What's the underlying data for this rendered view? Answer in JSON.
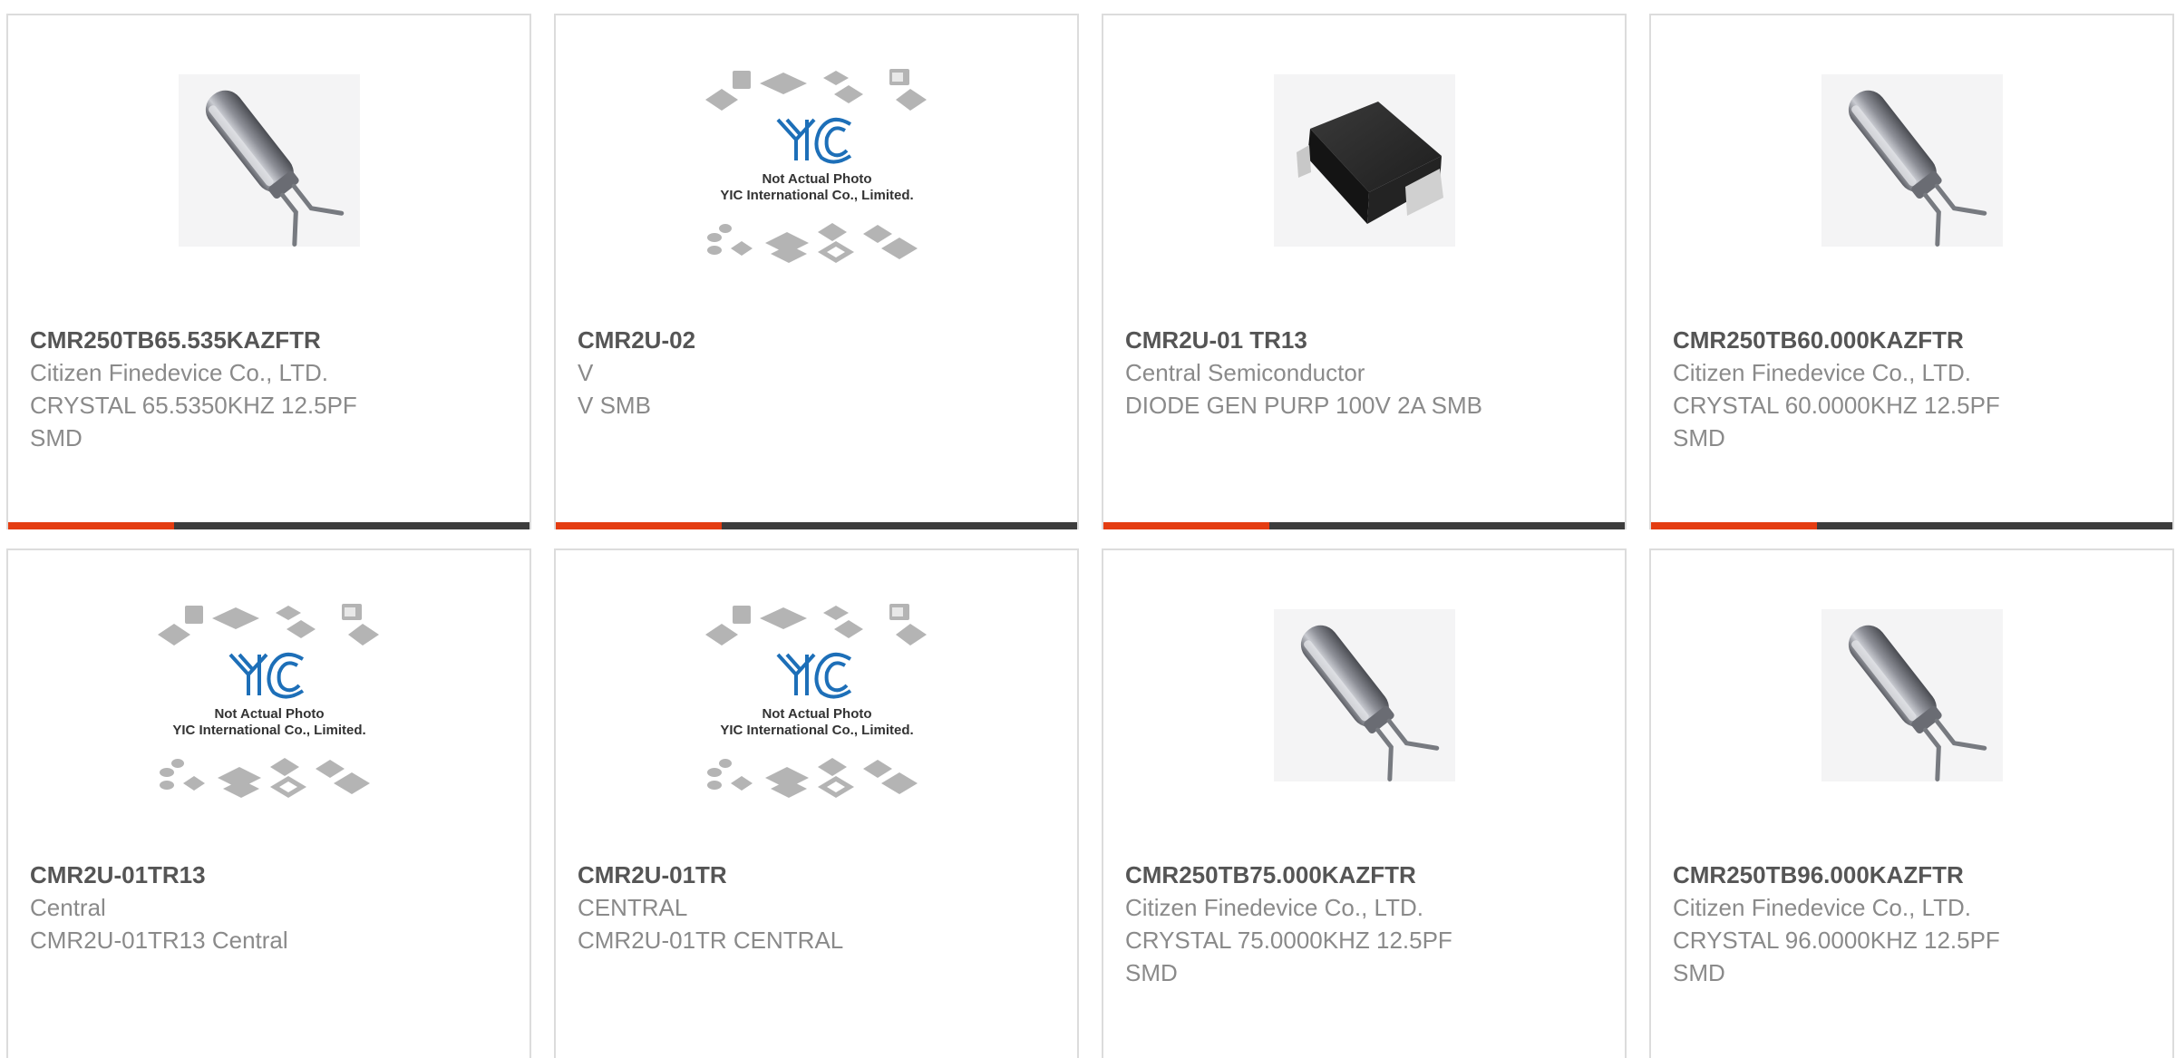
{
  "colors": {
    "accent": "#e43d12",
    "bar": "#3d3d3d",
    "part_number": "#555555",
    "text": "#8a8a8a",
    "border": "#dcdcdc",
    "logo_blue": "#1d6fb8"
  },
  "placeholder": {
    "brand": "YIC",
    "line1": "Not Actual Photo",
    "line2": "YIC International Co., Limited."
  },
  "products": [
    {
      "part_number": "CMR250TB65.535KAZFTR",
      "manufacturer": "Citizen Finedevice Co., LTD.",
      "description": "CRYSTAL 65.5350KHZ 12.5PF SMD",
      "image": "crystal-photo"
    },
    {
      "part_number": "CMR2U-02",
      "manufacturer": "V",
      "description": "V SMB",
      "image": "placeholder-photo"
    },
    {
      "part_number": "CMR2U-01 TR13",
      "manufacturer": "Central Semiconductor",
      "description": "DIODE GEN PURP 100V 2A SMB",
      "image": "diode-photo"
    },
    {
      "part_number": "CMR250TB60.000KAZFTR",
      "manufacturer": "Citizen Finedevice Co., LTD.",
      "description": "CRYSTAL 60.0000KHZ 12.5PF SMD",
      "image": "crystal-photo"
    },
    {
      "part_number": "CMR2U-01TR13",
      "manufacturer": "Central",
      "description": "CMR2U-01TR13 Central",
      "image": "placeholder-photo"
    },
    {
      "part_number": "CMR2U-01TR",
      "manufacturer": "CENTRAL",
      "description": "CMR2U-01TR CENTRAL",
      "image": "placeholder-photo"
    },
    {
      "part_number": "CMR250TB75.000KAZFTR",
      "manufacturer": "Citizen Finedevice Co., LTD.",
      "description": "CRYSTAL 75.0000KHZ 12.5PF SMD",
      "image": "crystal-photo"
    },
    {
      "part_number": "CMR250TB96.000KAZFTR",
      "manufacturer": "Citizen Finedevice Co., LTD.",
      "description": "CRYSTAL 96.0000KHZ 12.5PF SMD",
      "image": "crystal-photo"
    }
  ]
}
